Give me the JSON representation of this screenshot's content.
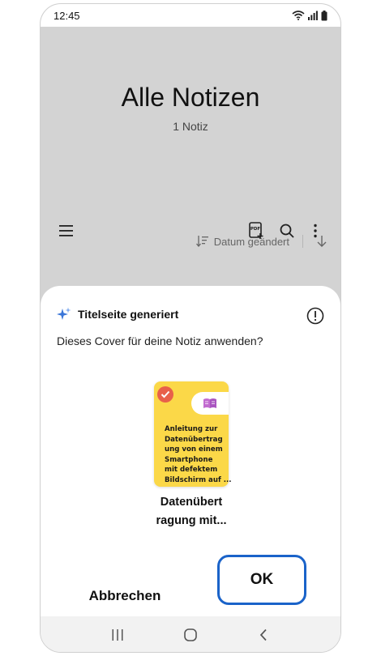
{
  "status_bar": {
    "time": "12:45",
    "icons": [
      "wifi-icon",
      "signal-icon",
      "battery-icon"
    ]
  },
  "header": {
    "title": "Alle Notizen",
    "subtitle": "1 Notiz"
  },
  "toolbar": {
    "icons": [
      "menu-icon",
      "pdf-add-icon",
      "search-icon",
      "more-icon"
    ]
  },
  "sort": {
    "label": "Datum geändert",
    "icon": "sort-icon",
    "direction_icon": "arrow-down-icon"
  },
  "dialog": {
    "title": "Titelseite generiert",
    "title_icon": "ai-sparkle-icon",
    "info_icon": "info-icon",
    "question": "Dieses Cover für deine Notiz anwenden?",
    "cover": {
      "selected": true,
      "icon": "book-icon",
      "text_lines": [
        "Anleitung zur",
        "Datenübertrag",
        "ung von einem",
        "Smartphone",
        "mit defektem",
        "Bildschirm auf ..."
      ],
      "caption_lines": [
        "Datenübert",
        "ragung mit..."
      ],
      "color": "#fbd848"
    },
    "cancel_label": "Abbrechen",
    "ok_label": "OK",
    "ok_highlight_color": "#1a63c9"
  },
  "nav_bar": {
    "buttons": [
      "recent-apps-icon",
      "home-icon",
      "back-icon"
    ]
  }
}
